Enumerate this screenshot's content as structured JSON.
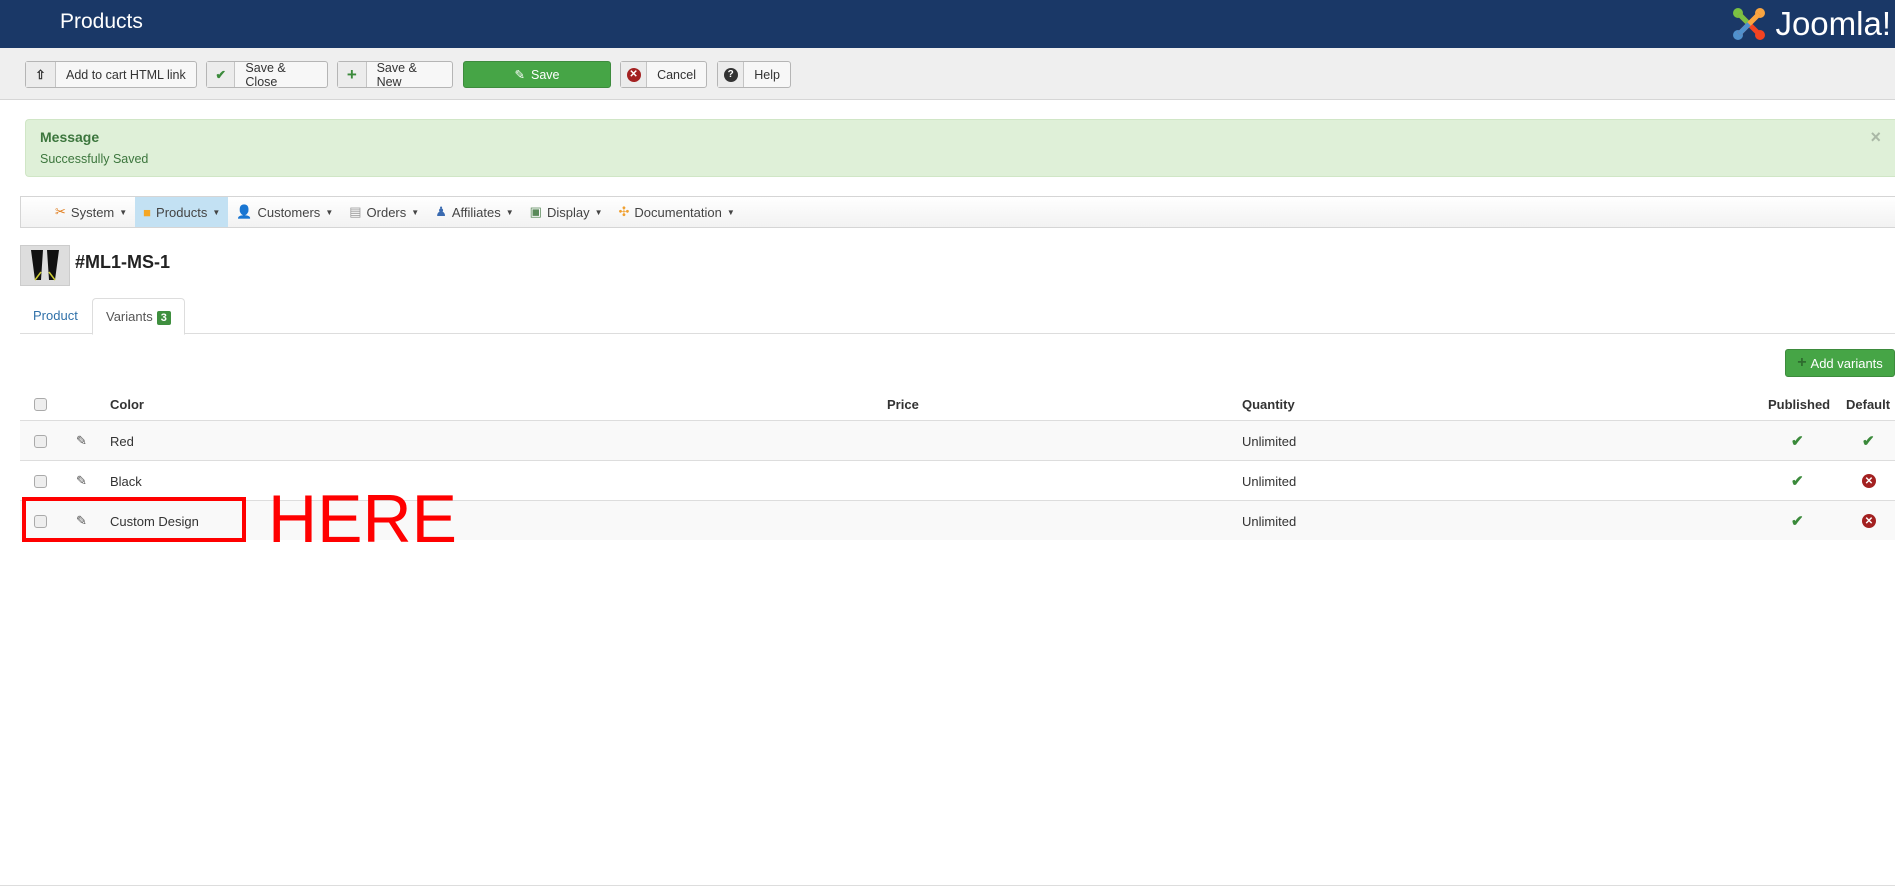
{
  "header": {
    "title": "Products",
    "logo_text": "Joomla!"
  },
  "toolbar": {
    "add_to_cart": "Add to cart HTML link",
    "save_close": "Save & Close",
    "save_new": "Save & New",
    "save": "Save",
    "cancel": "Cancel",
    "help": "Help"
  },
  "message": {
    "heading": "Message",
    "text": "Successfully Saved",
    "close": "×"
  },
  "submenu": [
    "System",
    "Products",
    "Customers",
    "Orders",
    "Affiliates",
    "Display",
    "Documentation"
  ],
  "product": {
    "title": "#ML1-MS-1"
  },
  "tabs": {
    "product": "Product",
    "variants": "Variants",
    "variants_count": "3"
  },
  "add_variants": "Add variants",
  "table": {
    "headers": {
      "color": "Color",
      "price": "Price",
      "quantity": "Quantity",
      "published": "Published",
      "default": "Default"
    },
    "rows": [
      {
        "color": "Red",
        "price": "",
        "quantity": "Unlimited",
        "published": true,
        "default": true
      },
      {
        "color": "Black",
        "price": "",
        "quantity": "Unlimited",
        "published": true,
        "default": false
      },
      {
        "color": "Custom Design",
        "price": "",
        "quantity": "Unlimited",
        "published": true,
        "default": false
      }
    ]
  },
  "annotation": {
    "text": "HERE",
    "color": "#ff0000"
  },
  "colors": {
    "header": "#1a3867",
    "save": "#46a546",
    "message_bg": "#dff0d8"
  }
}
